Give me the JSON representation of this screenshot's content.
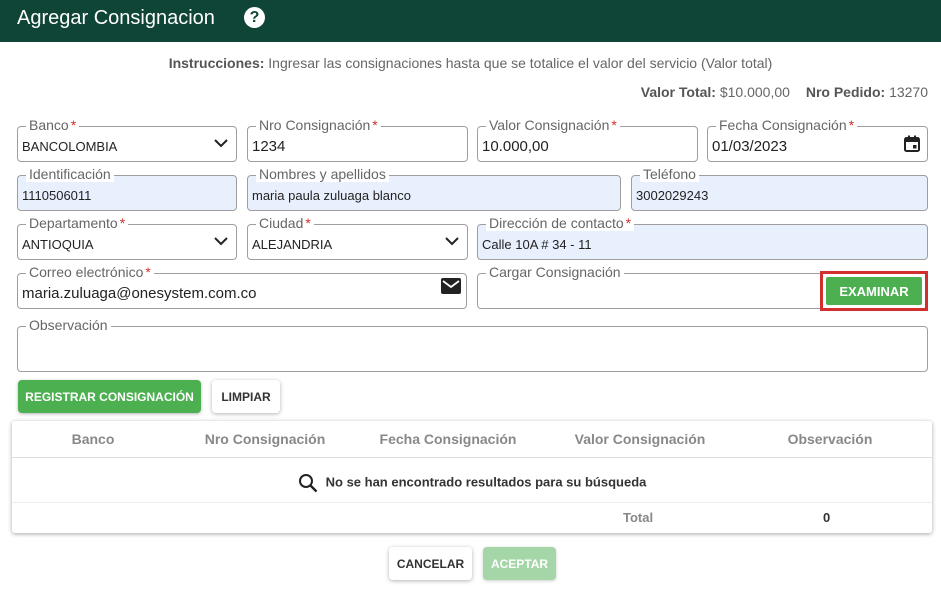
{
  "header": {
    "title": "Agregar Consignacion",
    "help": "?"
  },
  "instructions": {
    "label": "Instrucciones:",
    "text": "Ingresar las consignaciones hasta que se totalice el valor del servicio (Valor total)"
  },
  "totals": {
    "valor_total_label": "Valor Total:",
    "valor_total": "$10.000,00",
    "pedido_label": "Nro Pedido:",
    "pedido": "13270"
  },
  "form": {
    "banco": {
      "label": "Banco",
      "value": "BANCOLOMBIA"
    },
    "nro_consignacion": {
      "label": "Nro Consignación",
      "value": "1234"
    },
    "valor_consignacion": {
      "label": "Valor Consignación",
      "value": "10.000,00"
    },
    "fecha_consignacion": {
      "label": "Fecha Consignación",
      "value": "01/03/2023"
    },
    "identificacion": {
      "label": "Identificación",
      "value": "1110506011"
    },
    "nombres": {
      "label": "Nombres y apellidos",
      "value": "maria paula zuluaga blanco"
    },
    "telefono": {
      "label": "Teléfono",
      "value": "3002029243"
    },
    "departamento": {
      "label": "Departamento",
      "value": "ANTIOQUIA"
    },
    "ciudad": {
      "label": "Ciudad",
      "value": "ALEJANDRIA"
    },
    "direccion": {
      "label": "Dirección de contacto",
      "value": "Calle 10A # 34 - 11"
    },
    "correo": {
      "label": "Correo electrónico",
      "value": "maria.zuluaga@onesystem.com.co"
    },
    "cargar": {
      "label": "Cargar Consignación",
      "button": "EXAMINAR"
    },
    "observacion": {
      "label": "Observación",
      "value": ""
    },
    "required_mark": "*"
  },
  "actions": {
    "registrar": "REGISTRAR CONSIGNACIÓN",
    "limpiar": "LIMPIAR"
  },
  "table": {
    "columns": [
      "Banco",
      "Nro Consignación",
      "Fecha Consignación",
      "Valor Consignación",
      "Observación"
    ],
    "empty_message": "No se han encontrado resultados para su búsqueda",
    "total_label": "Total",
    "total_value": "0"
  },
  "footer": {
    "cancelar": "CANCELAR",
    "aceptar": "ACEPTAR"
  },
  "colors": {
    "header_bg": "#0f4536",
    "primary_green": "#4caf50",
    "disabled_green": "#a5d6a7",
    "required_red": "#d32f2f",
    "autofill_blue": "#e8f0fe",
    "highlight_border": "#d32f2f"
  },
  "icons": {
    "help": "help-icon",
    "dropdown": "chevron-down-icon",
    "calendar": "calendar-icon",
    "email": "envelope-icon",
    "search": "search-icon"
  }
}
